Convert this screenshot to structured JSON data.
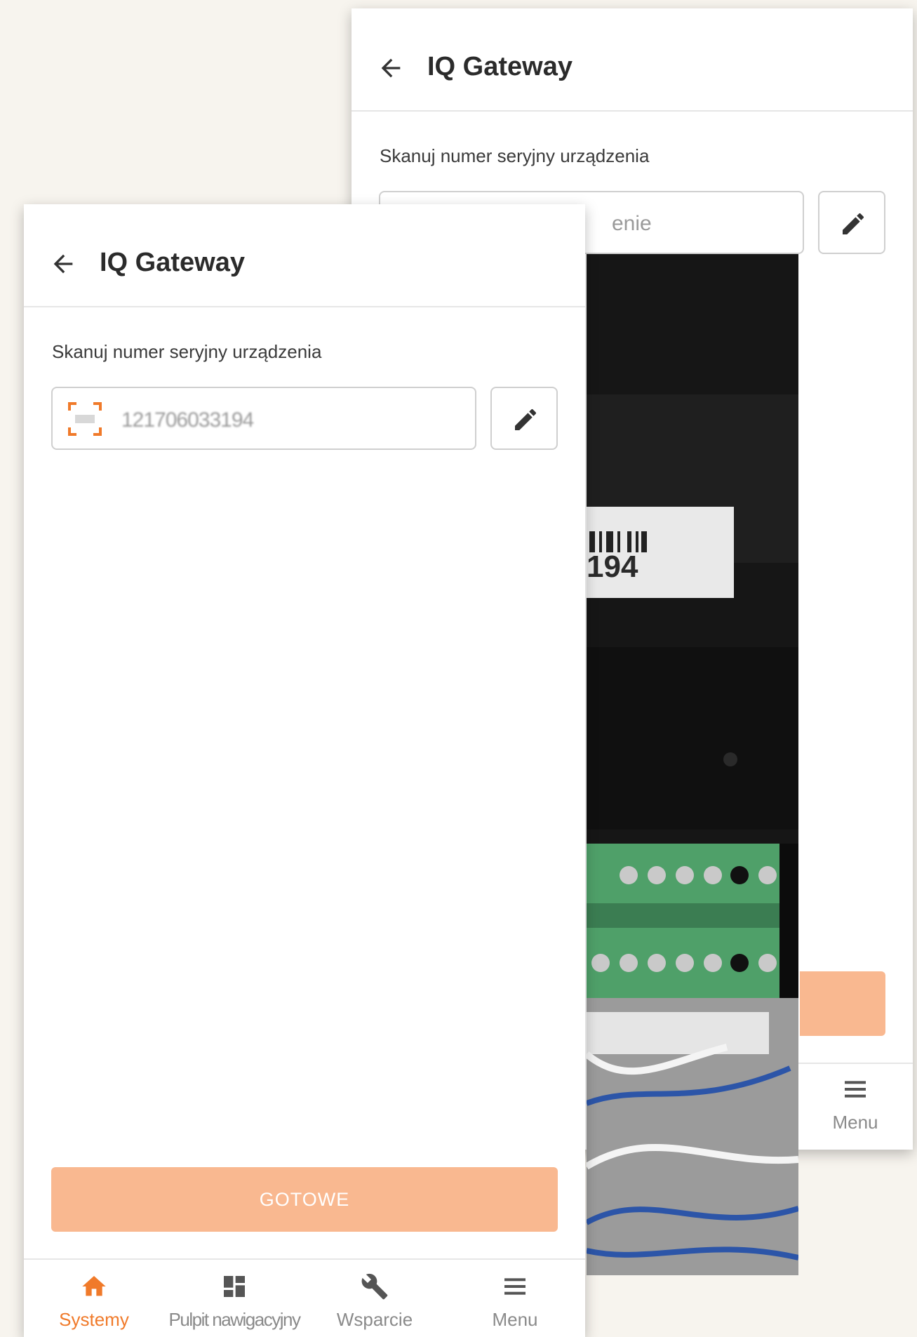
{
  "back_screen": {
    "title": "IQ Gateway",
    "scan_label": "Skanuj numer seryjny urządzenia",
    "input_fragment": "enie",
    "camera_label_text": "194",
    "nav_menu_label": "Menu"
  },
  "front_screen": {
    "title": "IQ Gateway",
    "scan_label": "Skanuj numer seryjny urządzenia",
    "serial_value": "121706033194",
    "done_button_label": "GOTOWE",
    "bottom_nav": {
      "items": [
        {
          "label": "Systemy",
          "icon": "home-icon",
          "active": true
        },
        {
          "label": "Pulpit nawigacyjny",
          "icon": "dashboard-icon",
          "active": false
        },
        {
          "label": "Wsparcie",
          "icon": "wrench-icon",
          "active": false
        },
        {
          "label": "Menu",
          "icon": "menu-icon",
          "active": false
        }
      ]
    }
  },
  "colors": {
    "accent": "#f07a2a",
    "button_disabled": "#f9b890",
    "background": "#f7f4ee"
  }
}
